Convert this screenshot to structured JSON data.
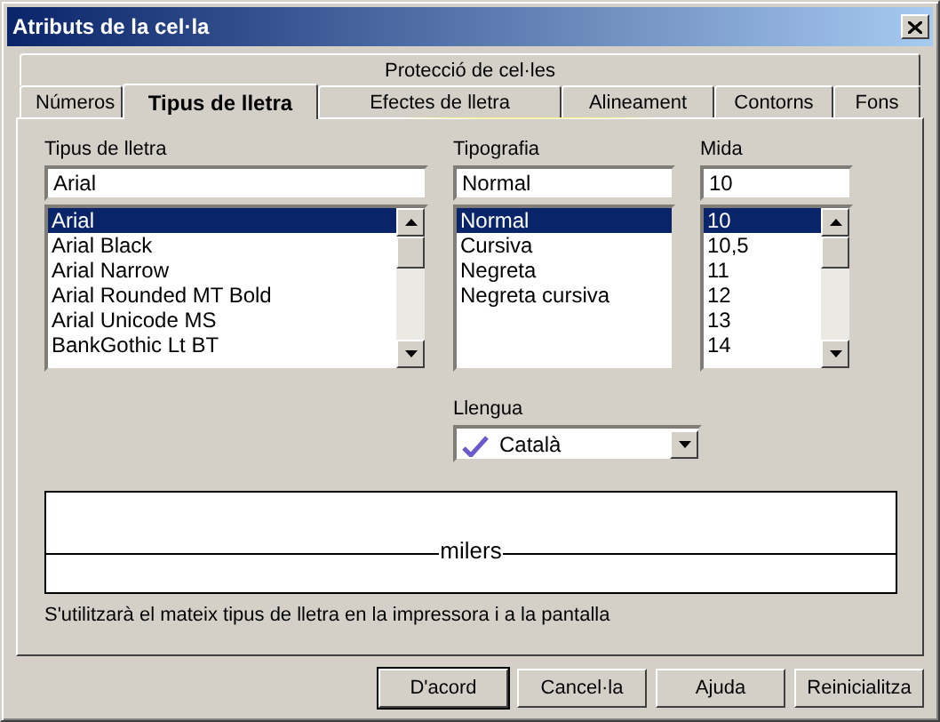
{
  "window": {
    "title": "Atributs de la cel·la"
  },
  "tabs_back_row": [
    {
      "label": "Protecció de cel·les",
      "selected": false
    }
  ],
  "tabs": [
    {
      "label": "Números",
      "selected": false
    },
    {
      "label": "Tipus de lletra",
      "selected": true
    },
    {
      "label": "Efectes de lletra",
      "selected": false
    },
    {
      "label": "Alineament",
      "selected": false
    },
    {
      "label": "Contorns",
      "selected": false
    },
    {
      "label": "Fons",
      "selected": false
    }
  ],
  "font": {
    "label": "Tipus de lletra",
    "value": "Arial",
    "scrollable": true,
    "options": [
      {
        "label": "Arial",
        "selected": true
      },
      {
        "label": "Arial Black",
        "selected": false
      },
      {
        "label": "Arial Narrow",
        "selected": false
      },
      {
        "label": "Arial Rounded MT Bold",
        "selected": false
      },
      {
        "label": "Arial Unicode MS",
        "selected": false
      },
      {
        "label": "BankGothic Lt BT",
        "selected": false
      }
    ]
  },
  "typeface": {
    "label": "Tipografia",
    "value": "Normal",
    "scrollable": false,
    "options": [
      {
        "label": "Normal",
        "selected": true
      },
      {
        "label": "Cursiva",
        "selected": false
      },
      {
        "label": "Negreta",
        "selected": false
      },
      {
        "label": "Negreta cursiva",
        "selected": false
      }
    ]
  },
  "size": {
    "label": "Mida",
    "value": "10",
    "scrollable": true,
    "options": [
      {
        "label": "10",
        "selected": true
      },
      {
        "label": "10,5",
        "selected": false
      },
      {
        "label": "11",
        "selected": false
      },
      {
        "label": "12",
        "selected": false
      },
      {
        "label": "13",
        "selected": false
      },
      {
        "label": "14",
        "selected": false
      }
    ]
  },
  "language": {
    "label": "Llengua",
    "value": "Català"
  },
  "preview": {
    "text": "milers"
  },
  "note": "S'utilitzarà el mateix tipus de lletra en la impressora i a la pantalla",
  "buttons": [
    {
      "label": "D'acord",
      "default": true
    },
    {
      "label": "Cancel·la",
      "default": false
    },
    {
      "label": "Ajuda",
      "default": false
    },
    {
      "label": "Reinicialitza",
      "default": false
    }
  ]
}
